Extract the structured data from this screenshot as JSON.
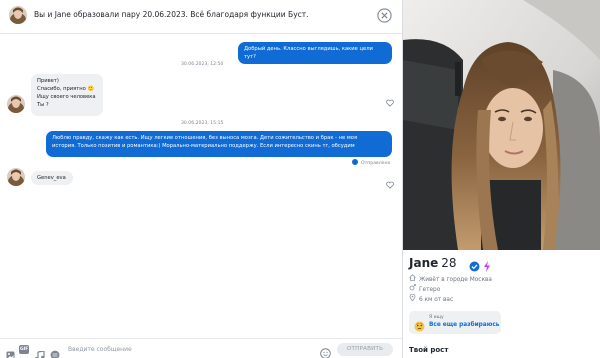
{
  "header": {
    "title": "Вы и Jane образовали пару 20.06.2023. Всё благодаря функции Буст.",
    "close_icon": "close-circle-icon"
  },
  "messages": [
    {
      "type": "timestamp",
      "text": ""
    },
    {
      "type": "outgoing",
      "text": "Добрый день. Классно выглядишь, какие цели тут?"
    },
    {
      "type": "timestamp",
      "text": "30.06.2023, 12:50"
    },
    {
      "type": "incoming",
      "lines": [
        "Привет)",
        "Спасибо, приятно 🙂",
        "Ищу своего человека",
        "Ты ?"
      ]
    },
    {
      "type": "timestamp",
      "text": "30.06.2023, 15:15"
    },
    {
      "type": "outgoing",
      "lines": [
        "Люблю правду, скажу как есть. Ищу легкие отношения, без выноса мозга. Дети сожительство и брак - не моя",
        "история. Только позитив и романтика:) Морально-материально поддержу. Если интересно скинь тг, обсудим"
      ]
    },
    {
      "type": "status",
      "text": "Отправлено"
    },
    {
      "type": "incoming",
      "text": "Genev_eva"
    }
  ],
  "composer": {
    "placeholder": "Введите сообщение",
    "send_label": "ОТПРАВИТЬ",
    "gif_label": "GIF",
    "tools": [
      "image-icon",
      "gif-icon",
      "music-icon",
      "emoji-icon"
    ]
  },
  "profile": {
    "name": "Jane",
    "age": "28",
    "badges": [
      "verified-icon",
      "boost-bolt-icon"
    ],
    "info": [
      {
        "icon": "home-icon",
        "text": "Живёт в городе Москва"
      },
      {
        "icon": "gender-icon",
        "text": "Гетеро"
      },
      {
        "icon": "location-pin-icon",
        "text": "6 км от вас"
      }
    ],
    "looking_for": {
      "label": "Я ищу",
      "value": "Все еще разбираюсь",
      "emoji": "thinking-face-emoji"
    },
    "section_title": "Твой рост"
  },
  "colors": {
    "accent": "#106bd5",
    "bubble_in": "#eef0f2",
    "boost": "#c13ff0"
  }
}
